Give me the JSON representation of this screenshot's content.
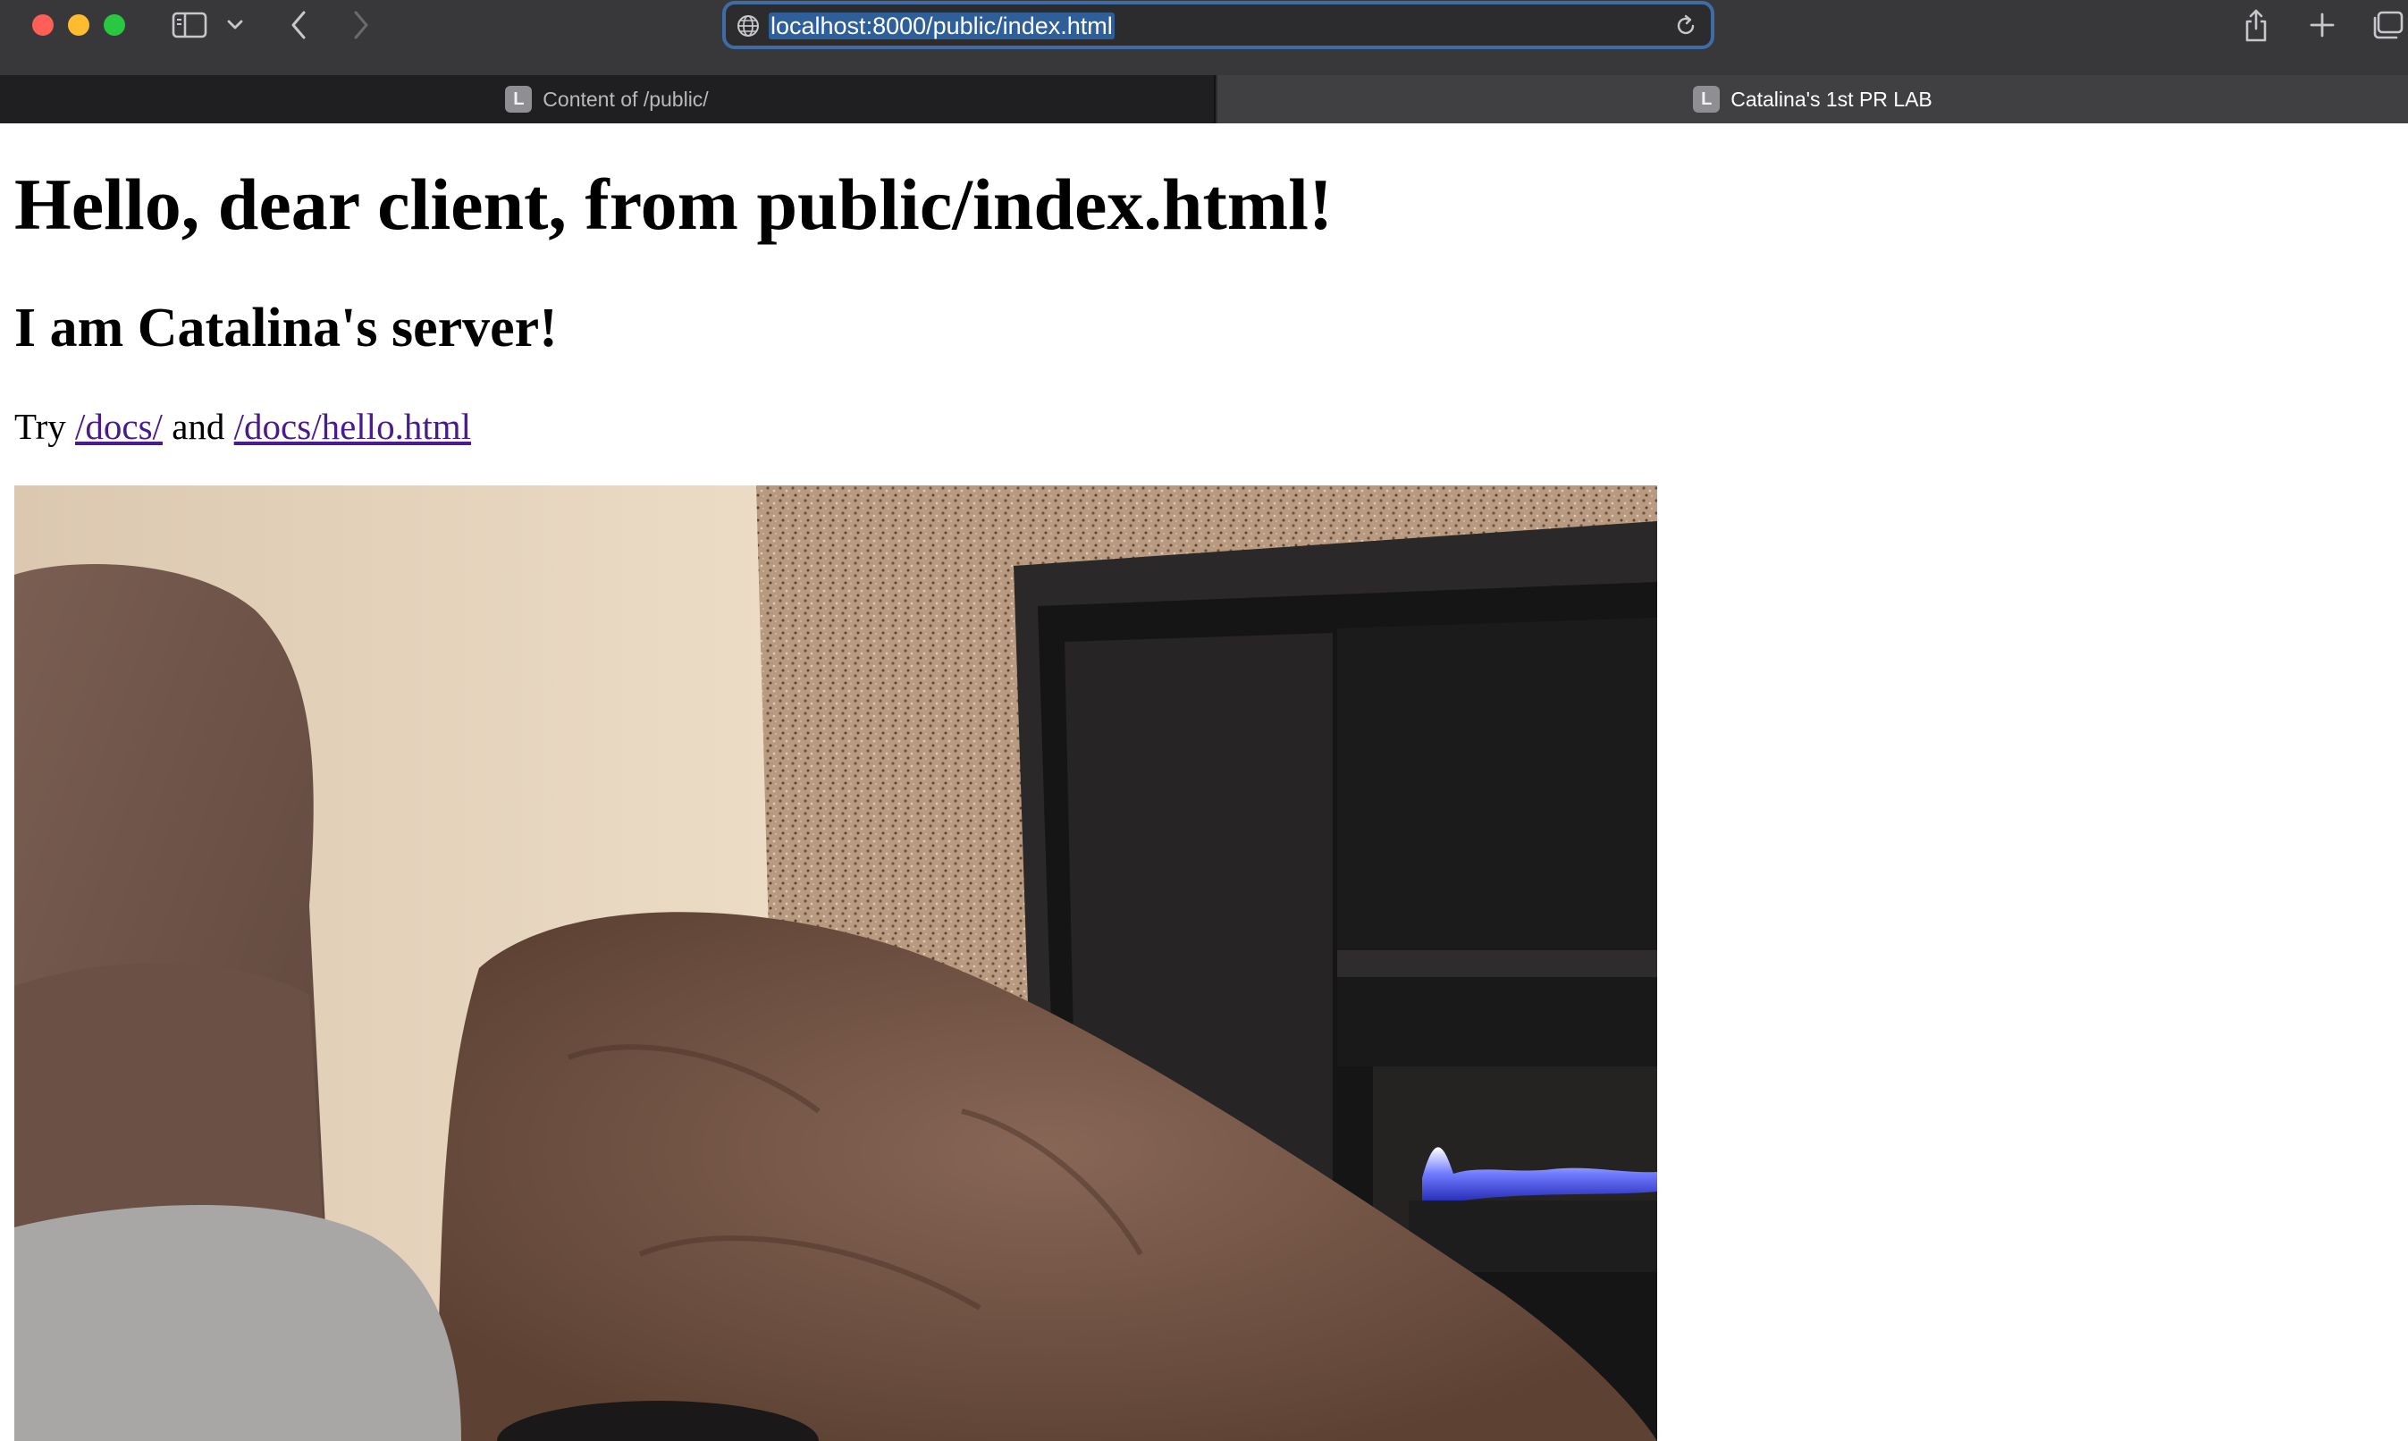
{
  "browser": {
    "url": "localhost:8000/public/index.html",
    "tabs": [
      {
        "favicon": "L",
        "title": "Content of /public/",
        "active": false
      },
      {
        "favicon": "L",
        "title": "Catalina's 1st PR LAB",
        "active": true
      }
    ],
    "accent_color": "#3e6ca7"
  },
  "page": {
    "heading": "Hello, dear client, from public/index.html!",
    "subheading": "I am Catalina's server!",
    "try_prefix": "Try",
    "link_docs": "/docs/",
    "joiner": "and",
    "link_hello": "/docs/hello.html"
  },
  "icons": {
    "sidebar": "sidebar-icon",
    "back": "chevron-left-icon",
    "forward": "chevron-right-icon",
    "share": "share-icon",
    "new_tab": "plus-icon",
    "tab_overview": "tab-overview-icon",
    "globe": "globe-icon",
    "reload": "reload-icon"
  }
}
